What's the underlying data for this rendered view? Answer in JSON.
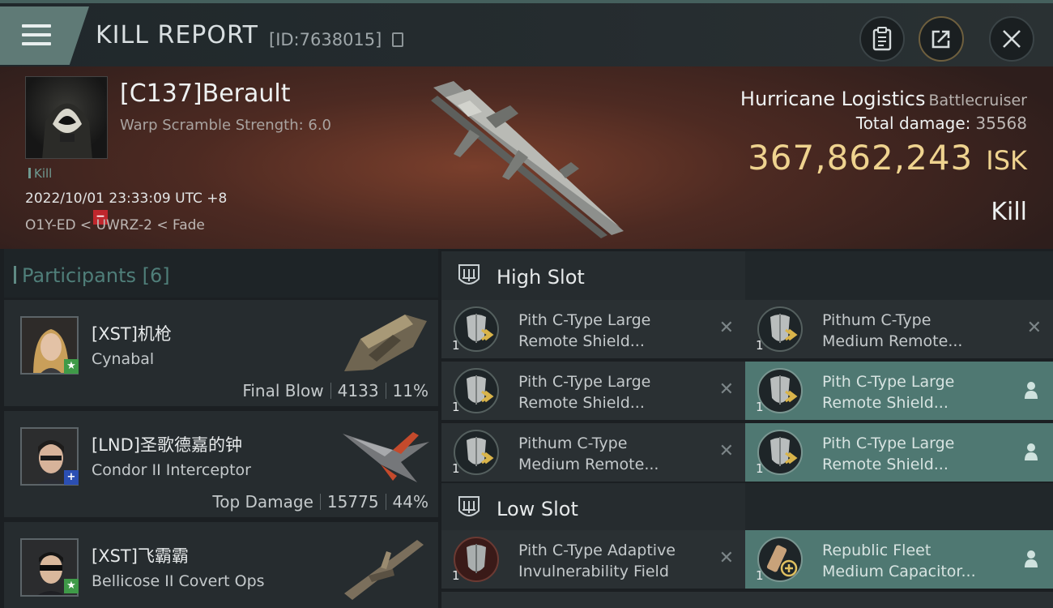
{
  "header": {
    "title": "KILL REPORT",
    "report_id": "[ID:7638015]",
    "icons": [
      "menu-icon",
      "copy-icon",
      "clipboard-icon",
      "export-icon",
      "close-icon"
    ]
  },
  "victim": {
    "pilot": "[C137]Berault",
    "warp_scramble": "Warp Scramble Strength: 6.0",
    "kill_tag": "Kill",
    "datetime": "2022/10/01 23:33:09 UTC +8",
    "location": "O1Y-ED < UWRZ-2 < Fade",
    "ship_name": "Hurricane Logistics",
    "ship_class": "Battlecruiser",
    "total_damage_label": "Total damage:",
    "total_damage": "35568",
    "isk_value": "367,862,243",
    "isk_unit": "ISK",
    "result": "Kill"
  },
  "participants": {
    "title": "Participants [6]",
    "rows": [
      {
        "name": "[XST]机枪",
        "ship": "Cynabal",
        "stat_label": "Final Blow",
        "damage": "4133",
        "percent": "11%",
        "badge": "★"
      },
      {
        "name": "[LND]圣歌德嘉的钟",
        "ship": "Condor II Interceptor",
        "stat_label": "Top Damage",
        "damage": "15775",
        "percent": "44%",
        "badge": "+"
      },
      {
        "name": "[XST]飞霸霸",
        "ship": "Bellicose II Covert Ops",
        "badge": "★"
      }
    ]
  },
  "high_slot": {
    "title": "High Slot",
    "modules": [
      {
        "name_line1": "Pith C-Type Large",
        "name_line2": "Remote Shield...",
        "qty": "1",
        "status": "destroyed"
      },
      {
        "name_line1": "Pithum C-Type",
        "name_line2": "Medium Remote...",
        "qty": "1",
        "status": "destroyed"
      },
      {
        "name_line1": "Pith C-Type Large",
        "name_line2": "Remote Shield...",
        "qty": "1",
        "status": "destroyed"
      },
      {
        "name_line1": "Pith C-Type Large",
        "name_line2": "Remote Shield...",
        "qty": "1",
        "status": "dropped"
      },
      {
        "name_line1": "Pithum C-Type",
        "name_line2": "Medium Remote...",
        "qty": "1",
        "status": "destroyed"
      },
      {
        "name_line1": "Pith C-Type Large",
        "name_line2": "Remote Shield...",
        "qty": "1",
        "status": "dropped"
      }
    ]
  },
  "low_slot": {
    "title": "Low Slot",
    "modules": [
      {
        "name_line1": "Pith C-Type Adaptive",
        "name_line2": "Invulnerability Field",
        "qty": "1",
        "status": "destroyed"
      },
      {
        "name_line1": "Republic Fleet",
        "name_line2": "Medium Capacitor...",
        "qty": "1",
        "status": "dropped"
      }
    ]
  }
}
